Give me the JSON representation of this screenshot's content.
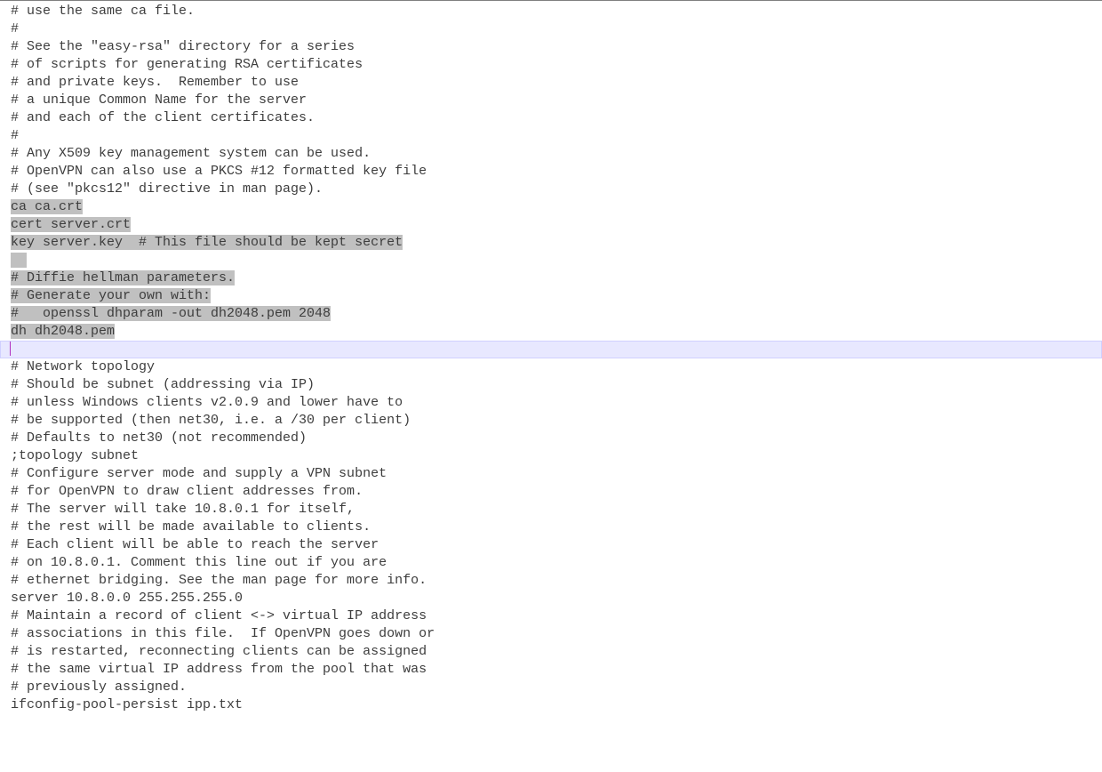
{
  "editor": {
    "lines": [
      {
        "text": "# use the same ca file.",
        "sel": false
      },
      {
        "text": "#",
        "sel": false
      },
      {
        "text": "# See the \"easy-rsa\" directory for a series",
        "sel": false
      },
      {
        "text": "# of scripts for generating RSA certificates",
        "sel": false
      },
      {
        "text": "# and private keys.  Remember to use",
        "sel": false
      },
      {
        "text": "# a unique Common Name for the server",
        "sel": false
      },
      {
        "text": "# and each of the client certificates.",
        "sel": false
      },
      {
        "text": "#",
        "sel": false
      },
      {
        "text": "# Any X509 key management system can be used.",
        "sel": false
      },
      {
        "text": "# OpenVPN can also use a PKCS #12 formatted key file",
        "sel": false
      },
      {
        "text": "# (see \"pkcs12\" directive in man page).",
        "sel": false
      },
      {
        "text": "ca ca.crt",
        "sel": true
      },
      {
        "text": "cert server.crt",
        "sel": true
      },
      {
        "text": "key server.key  # This file should be kept secret",
        "sel": true
      },
      {
        "text": "  ",
        "sel": true
      },
      {
        "text": "# Diffie hellman parameters.",
        "sel": true
      },
      {
        "text": "# Generate your own with:",
        "sel": true
      },
      {
        "text": "#   openssl dhparam -out dh2048.pem 2048",
        "sel": true
      },
      {
        "text": "dh dh2048.pem",
        "sel": true
      },
      {
        "text": "",
        "sel": false,
        "cursor": true
      },
      {
        "text": "# Network topology",
        "sel": false
      },
      {
        "text": "# Should be subnet (addressing via IP)",
        "sel": false
      },
      {
        "text": "# unless Windows clients v2.0.9 and lower have to",
        "sel": false
      },
      {
        "text": "# be supported (then net30, i.e. a /30 per client)",
        "sel": false
      },
      {
        "text": "# Defaults to net30 (not recommended)",
        "sel": false
      },
      {
        "text": ";topology subnet",
        "sel": false
      },
      {
        "text": "",
        "sel": false
      },
      {
        "text": "# Configure server mode and supply a VPN subnet",
        "sel": false
      },
      {
        "text": "# for OpenVPN to draw client addresses from.",
        "sel": false
      },
      {
        "text": "# The server will take 10.8.0.1 for itself,",
        "sel": false
      },
      {
        "text": "# the rest will be made available to clients.",
        "sel": false
      },
      {
        "text": "# Each client will be able to reach the server",
        "sel": false
      },
      {
        "text": "# on 10.8.0.1. Comment this line out if you are",
        "sel": false
      },
      {
        "text": "# ethernet bridging. See the man page for more info.",
        "sel": false
      },
      {
        "text": "server 10.8.0.0 255.255.255.0",
        "sel": false
      },
      {
        "text": "",
        "sel": false
      },
      {
        "text": "# Maintain a record of client <-> virtual IP address",
        "sel": false
      },
      {
        "text": "# associations in this file.  If OpenVPN goes down or",
        "sel": false
      },
      {
        "text": "# is restarted, reconnecting clients can be assigned",
        "sel": false
      },
      {
        "text": "# the same virtual IP address from the pool that was",
        "sel": false
      },
      {
        "text": "# previously assigned.",
        "sel": false
      },
      {
        "text": "ifconfig-pool-persist ipp.txt",
        "sel": false
      },
      {
        "text": "",
        "sel": false
      }
    ]
  }
}
